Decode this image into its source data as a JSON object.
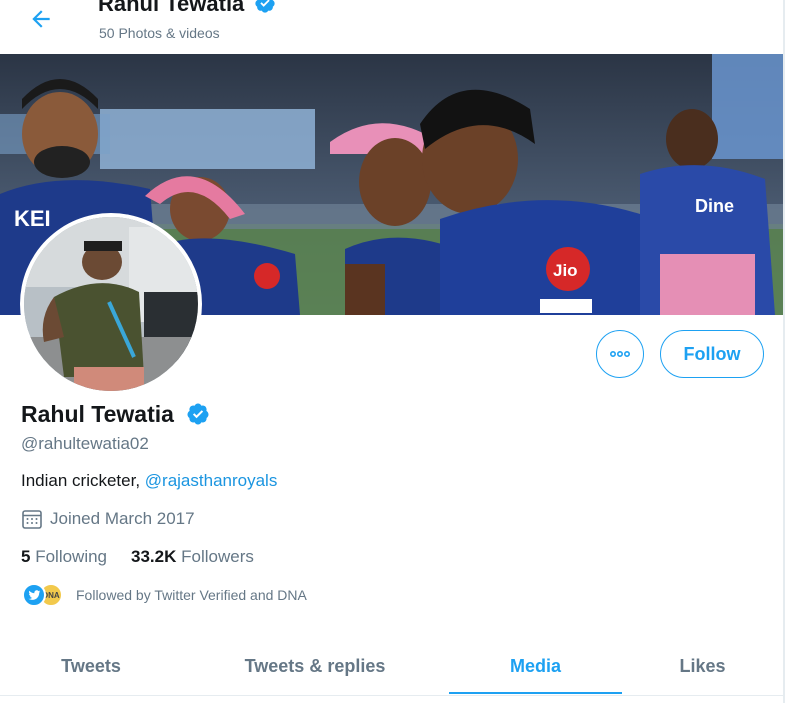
{
  "header": {
    "title": "Rahul Tewatia",
    "subtitle": "50 Photos & videos"
  },
  "profile": {
    "name": "Rahul Tewatia",
    "handle": "@rahultewatia02",
    "bio_text": "Indian cricketer, ",
    "bio_mention": "@rajasthanroyals",
    "joined": "Joined March 2017",
    "following_count": "5",
    "following_label": "Following",
    "followers_count": "33.2K",
    "followers_label": "Followers",
    "followed_by": "Followed by Twitter Verified and DNA"
  },
  "banner": {
    "jersey_text_left": "KEI",
    "jersey_sponsor": "Jio",
    "jersey_text_right": "Dine"
  },
  "actions": {
    "more_icon": "more-horizontal-icon",
    "follow_label": "Follow"
  },
  "tabs": [
    {
      "label": "Tweets"
    },
    {
      "label": "Tweets & replies"
    },
    {
      "label": "Media",
      "active": true
    },
    {
      "label": "Likes"
    }
  ],
  "colors": {
    "accent": "#1da1f2",
    "text": "#14171a",
    "muted": "#657786"
  }
}
